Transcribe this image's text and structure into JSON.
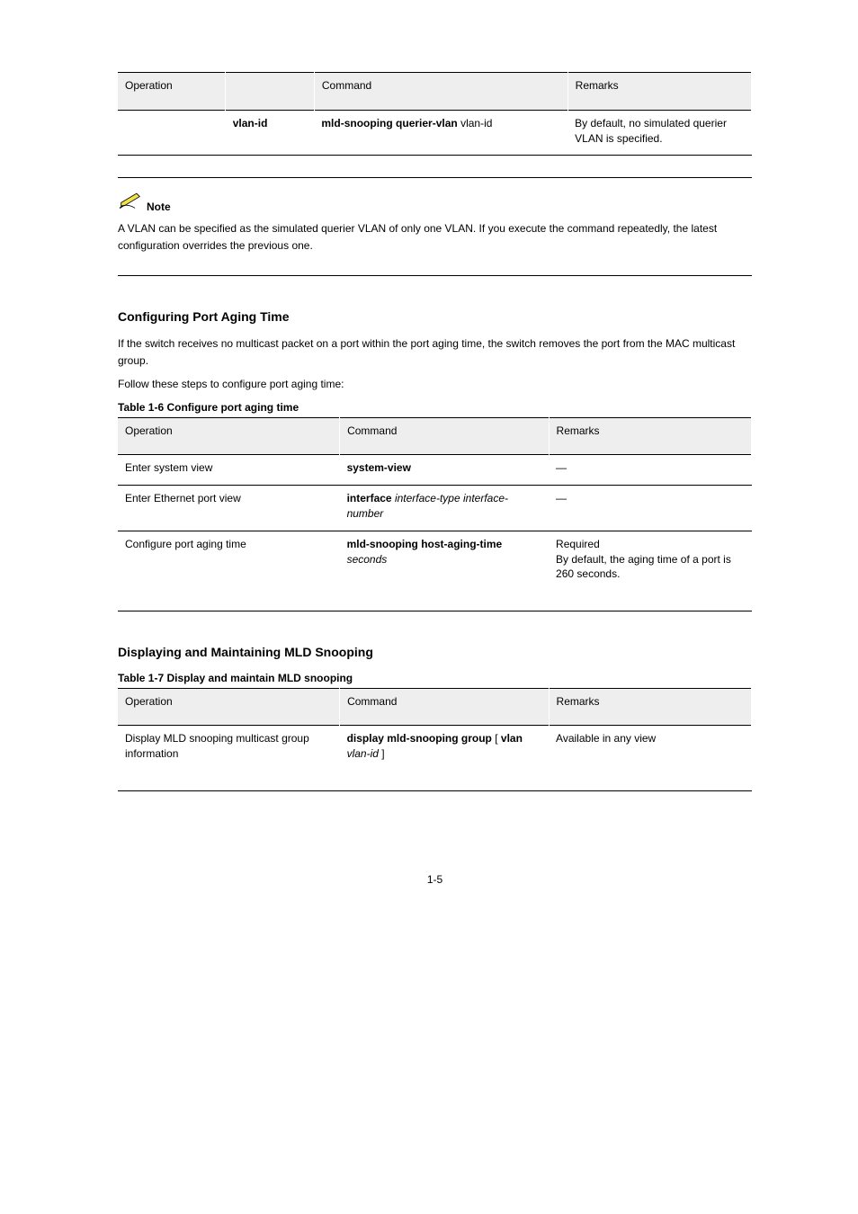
{
  "table1": {
    "headers": [
      "Operation",
      "",
      "Command",
      "Remarks"
    ],
    "row": {
      "c0": "",
      "c1": "vlan-id",
      "c2": "mld-snooping querier-vlan vlan-id",
      "c3": "By default, no simulated querier VLAN is specified."
    }
  },
  "note": {
    "label": "Note",
    "text": "A VLAN can be specified as the simulated querier VLAN of only one VLAN. If you execute the command repeatedly, the latest configuration overrides the previous one."
  },
  "sec1": {
    "title": "Configuring Port Aging Time",
    "p1": "If the switch receives no multicast packet on a port within the port aging time, the switch removes the port from the MAC multicast group.",
    "p2": "Follow these steps to configure port aging time:",
    "table_caption": "Table 1-6 Configure port aging time",
    "headers": [
      "Operation",
      "Command",
      "Remarks"
    ],
    "rows": [
      {
        "c0": "Enter system view",
        "c1": "system-view",
        "c2": "—"
      },
      {
        "c0": "Enter Ethernet port view",
        "c1": "interface interface-type interface-number",
        "c2": "—"
      },
      {
        "c0": "Configure port aging time",
        "c1": "mld-snooping host-aging-time seconds",
        "c2": "Required\nBy default, the aging time of a port is 260 seconds."
      }
    ]
  },
  "sec2": {
    "title": "Displaying and Maintaining MLD Snooping",
    "table_caption": "Table 1-7 Display and maintain MLD snooping",
    "headers": [
      "Operation",
      "Command",
      "Remarks"
    ],
    "row": {
      "c0": "Display MLD snooping multicast group information",
      "c1": "display mld-snooping group [ vlan vlan-id ]",
      "c2": "Available in any view"
    }
  },
  "page_no": "1-5"
}
